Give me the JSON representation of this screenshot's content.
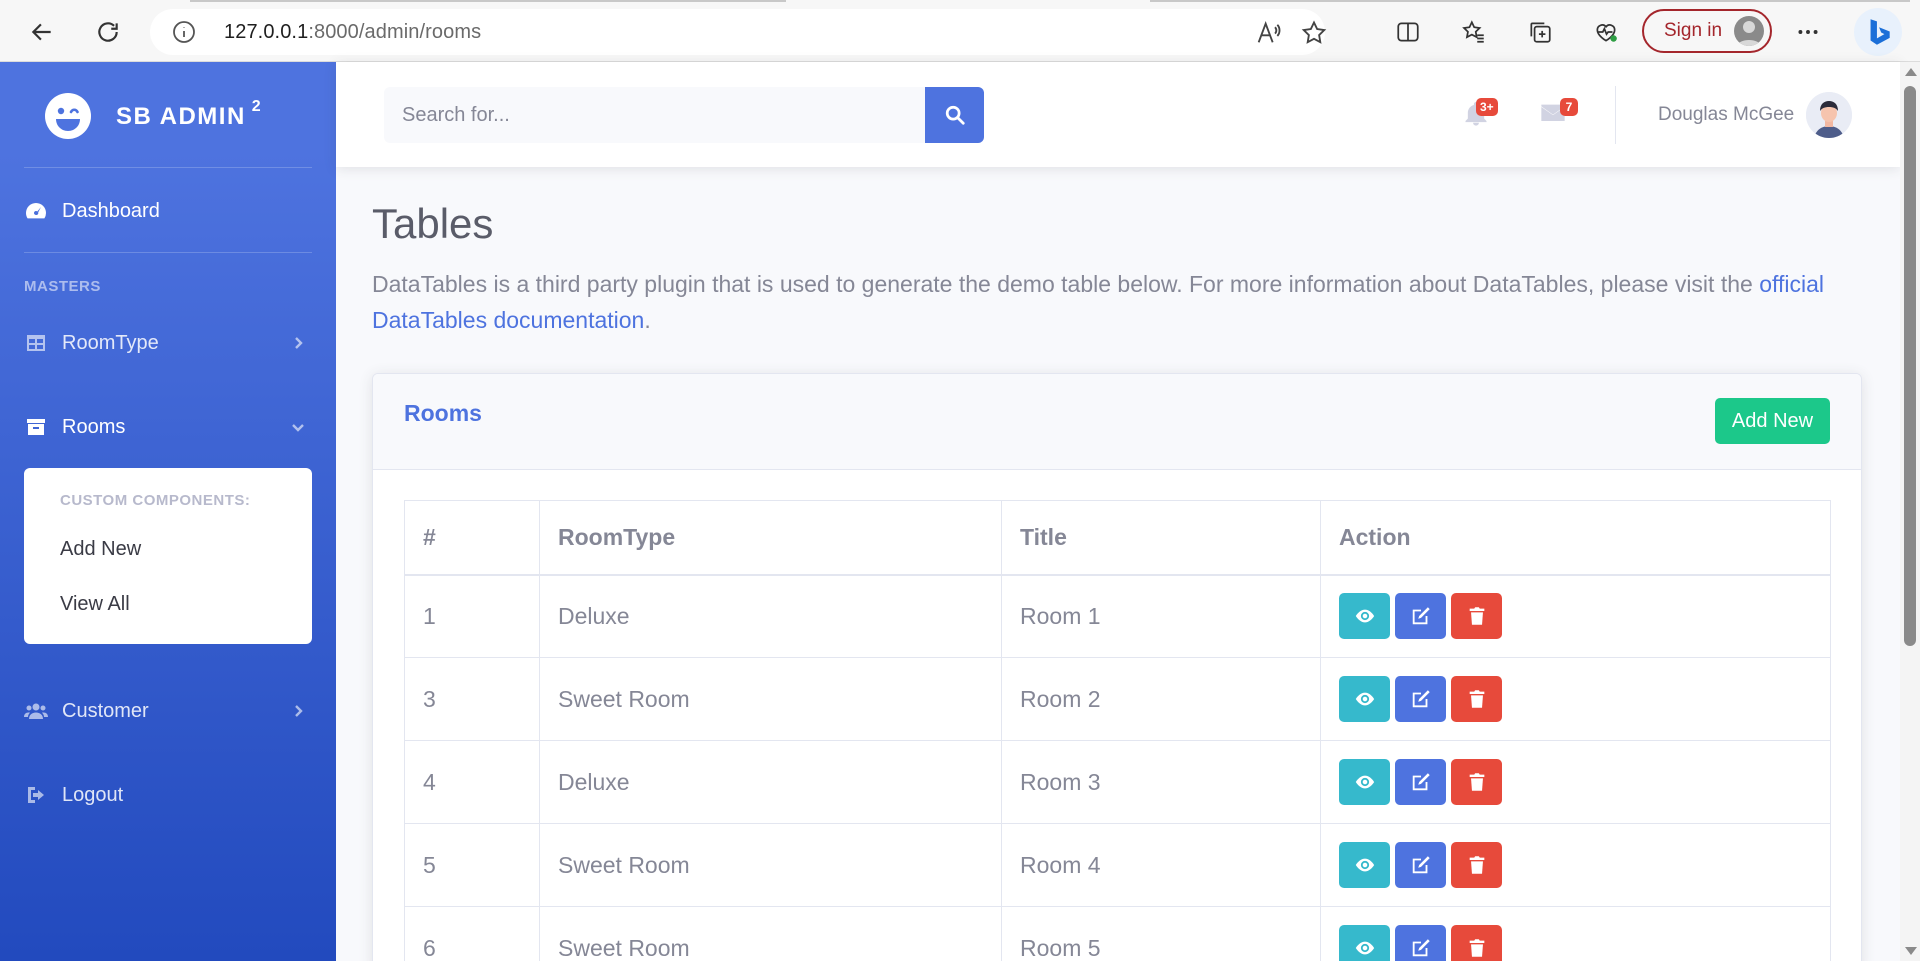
{
  "browser": {
    "url_host": "127.0.0.1",
    "url_path": ":8000/admin/rooms",
    "signin_label": "Sign in"
  },
  "sidebar": {
    "brand": "SB ADMIN",
    "brand_sup": "2",
    "dashboard_label": "Dashboard",
    "heading_masters": "MASTERS",
    "roomtype_label": "RoomType",
    "rooms_label": "Rooms",
    "collapse_header": "CUSTOM COMPONENTS:",
    "collapse_add_new": "Add New",
    "collapse_view_all": "View All",
    "customer_label": "Customer",
    "logout_label": "Logout"
  },
  "topbar": {
    "search_placeholder": "Search for...",
    "alerts_badge": "3+",
    "messages_badge": "7",
    "user_name": "Douglas McGee"
  },
  "main": {
    "title": "Tables",
    "description": "DataTables is a third party plugin that is used to generate the demo table below. For more information about DataTables, please visit the ",
    "description_link": "official DataTables documentation",
    "description_end": ".",
    "card_title": "Rooms",
    "add_new_label": "Add New",
    "table": {
      "headers": [
        "#",
        "RoomType",
        "Title",
        "Action"
      ],
      "rows": [
        {
          "id": "1",
          "roomtype": "Deluxe",
          "title": "Room 1"
        },
        {
          "id": "3",
          "roomtype": "Sweet Room",
          "title": "Room 2"
        },
        {
          "id": "4",
          "roomtype": "Deluxe",
          "title": "Room 3"
        },
        {
          "id": "5",
          "roomtype": "Sweet Room",
          "title": "Room 4"
        },
        {
          "id": "6",
          "roomtype": "Sweet Room",
          "title": "Room 5"
        }
      ]
    }
  },
  "colors": {
    "primary": "#4e73df",
    "success": "#1cc88a",
    "info": "#36b9cc",
    "danger": "#e74a3b"
  },
  "icons": {
    "view": "eye-icon",
    "edit": "edit-icon",
    "delete": "trash-icon"
  }
}
